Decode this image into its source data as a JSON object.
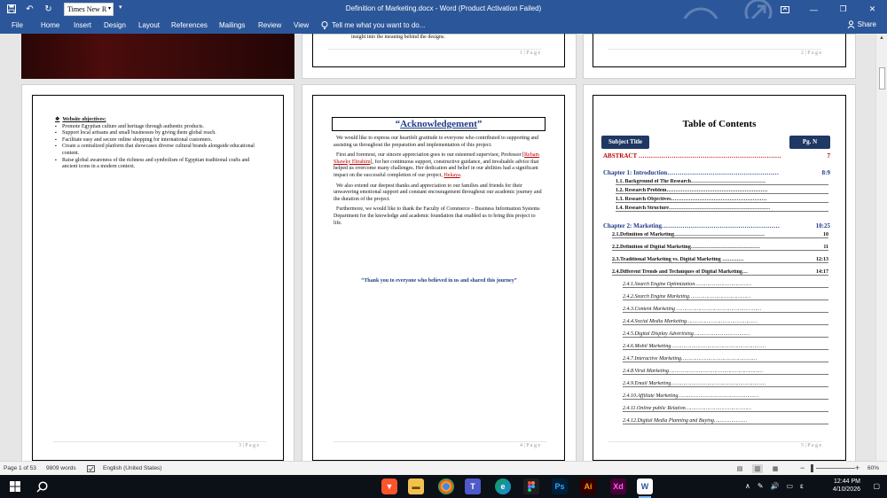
{
  "titlebar": {
    "font_name": "Times New R",
    "doc_title": "Definition of Marketing.docx - Word (Product Activation Failed)"
  },
  "ribbon": {
    "tabs": [
      "File",
      "Home",
      "Insert",
      "Design",
      "Layout",
      "References",
      "Mailings",
      "Review",
      "View"
    ],
    "tell_me": "Tell me what you want to do...",
    "share": "Share"
  },
  "pages_top": {
    "fragment_text": "insight into the meaning behind the designs.",
    "p1": "1 | P a g e",
    "p2": "2 | P a g e"
  },
  "page3": {
    "heading": "Website objectives:",
    "items": [
      "Promote Egyptian culture and heritage through authentic products.",
      "Support local artisans and small businesses by giving them global reach.",
      "Facilitate easy and secure online shopping for international customers.",
      "Create a centralized platform that showcases diverse cultural brands alongside educational content.",
      "Raise global awareness of the richness and symbolism of Egyptian traditional crafts and ancient icons in a modern context."
    ],
    "page_num": "3 | P a g e"
  },
  "page4": {
    "title_open": "“",
    "title": "Acknowledgement",
    "title_close": "”",
    "p1": "We would like to express our heartfelt gratitude to everyone who contributed to supporting and assisting us throughout the preparation and implementation of this project.",
    "p2a": "First and foremost, our sincere appreciation goes to our esteemed supervisor, Professor [",
    "p2name": "Reham Shawky Ebrahim",
    "p2b": "], for her continuous support, constructive guidance, and invaluable advice that helped us overcome many challenges. Her dedication and belief in our abilities had a significant impact on the successful completion of our project, ",
    "p2proj": "Hekaya",
    "p2c": ".",
    "p3": "We also extend our deepest thanks and appreciation to our families and friends for their unwavering emotional support and constant encouragement throughout our academic journey and the duration of the project.",
    "p4": "Furthermore, we would like to thank the Faculty of Commerce – Business Information Systems Department for the knowledge and academic foundation that enabled us to bring this project to life.",
    "quote": "“Thank you to everyone who believed in us and shared this journey”",
    "page_num": "4 | P a g e"
  },
  "page5": {
    "title": "Table of Contents",
    "col_subject": "Subject Title",
    "col_page": "Pg. N",
    "rows": [
      {
        "t": "ABSTRACT ……………………………………………………………",
        "p": "7"
      },
      {
        "t": "Chapter 1: Introduction………………………………………………",
        "p": "8:9"
      },
      {
        "t": "1.1. Background of The Research……………………………………",
        "p": ""
      },
      {
        "t": "1.2. Research Problem…………………………………………………",
        "p": ""
      },
      {
        "t": "1.3. Research Objectives………………………………………………",
        "p": ""
      },
      {
        "t": "1.4. Research Structure…………………………………………………",
        "p": ""
      },
      {
        "t": "Chapter 2: Marketing…………………………………………………",
        "p": "10:25"
      },
      {
        "t": "2.1.Definition of Marketing……………………………………………",
        "p": "10"
      },
      {
        "t": "2.2.Definition of Digital Marketing…………………………………",
        "p": "11"
      },
      {
        "t": "2.3.Traditional Marketing vs. Digital Marketing …………",
        "p": "12:13"
      },
      {
        "t": "2.4.Different Trends and Techniques of Digital Marketing…",
        "p": "14:17"
      },
      {
        "t": "2.4.1.Search Engine Optimization………………………………",
        "p": ""
      },
      {
        "t": "2.4.2.Search Engine Marketing…………………………………",
        "p": ""
      },
      {
        "t": "2.4.3.Content Marketing ………………………………………………",
        "p": ""
      },
      {
        "t": "2.4.4.Social Media Marketing………………………………………",
        "p": ""
      },
      {
        "t": "2.4.5.Digital Display Advertising………………………………",
        "p": ""
      },
      {
        "t": "2.4.6.Mobil Marketing……………………………………………………",
        "p": ""
      },
      {
        "t": "2.4.7.Interactive Marketing…………………………………………",
        "p": ""
      },
      {
        "t": "2.4.8.Viral Marketing……………………………………………………",
        "p": ""
      },
      {
        "t": "2.4.9.Email Marketing……………………………………………………",
        "p": ""
      },
      {
        "t": "2.4.10.Affiliate Marketing……………………………………………",
        "p": ""
      },
      {
        "t": "2.4.11.Online public Relation……………………………………",
        "p": ""
      },
      {
        "t": "2.4.12.Digital Media Planning and Buying…………………",
        "p": ""
      }
    ],
    "page_num": "5 | P a g e"
  },
  "status": {
    "page": "Page 1 of 53",
    "words": "9809 words",
    "lang": "English (United States)",
    "zoom": "60%"
  },
  "taskbar": {
    "time": "12:44 PM",
    "date": "4/10/2026",
    "lang": "ε"
  },
  "colors": {
    "word_blue": "#2b579a",
    "toc_header": "#1f3864",
    "accent_red": "#c00000",
    "heading_blue": "#1f3c88"
  }
}
